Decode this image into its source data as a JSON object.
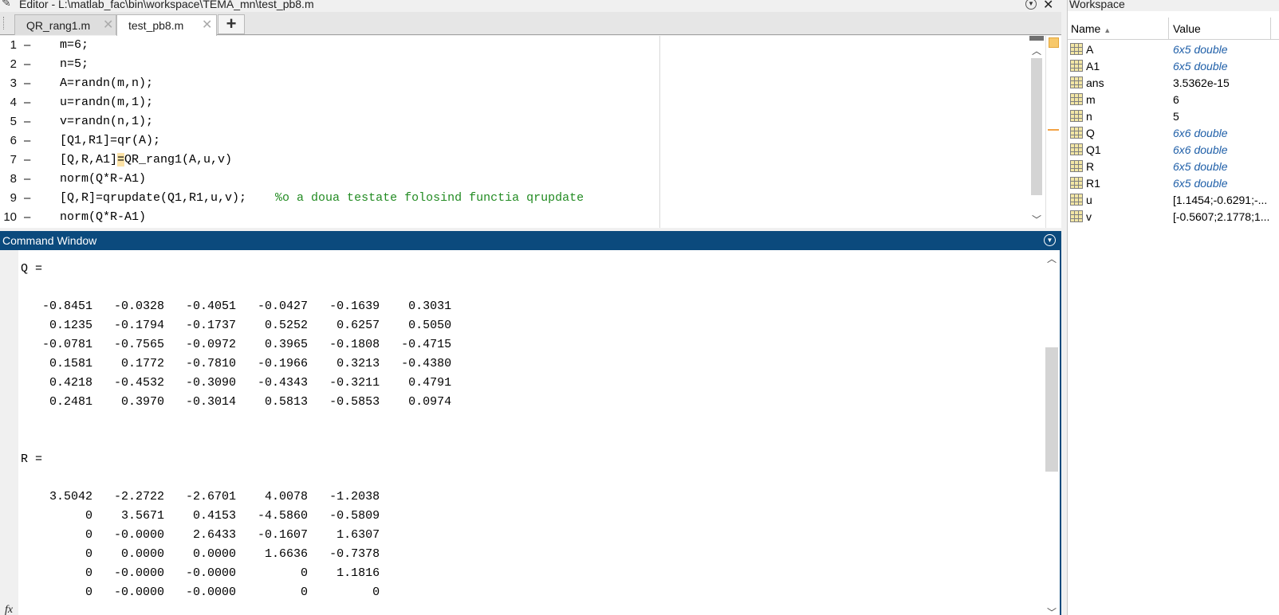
{
  "editor": {
    "title": "Editor - L:\\matlab_fac\\bin\\workspace\\TEMA_mn\\test_pb8.m",
    "tabs": [
      {
        "label": "QR_rang1.m"
      },
      {
        "label": "test_pb8.m"
      }
    ],
    "add_tab_label": "+",
    "lines": [
      {
        "num": "1",
        "code": "m=6;"
      },
      {
        "num": "2",
        "code": "n=5;"
      },
      {
        "num": "3",
        "code": "A=randn(m,n);"
      },
      {
        "num": "4",
        "code": "u=randn(m,1);"
      },
      {
        "num": "5",
        "code": "v=randn(n,1);"
      },
      {
        "num": "6",
        "code": "[Q1,R1]=qr(A);"
      },
      {
        "num": "7",
        "code_pre": "[Q,R,A1]",
        "code_hl": "=",
        "code_post": "QR_rang1(A,u,v)"
      },
      {
        "num": "8",
        "code": "norm(Q*R-A1)"
      },
      {
        "num": "9",
        "code": "[Q,R]=qrupdate(Q1,R1,u,v);    ",
        "comment": "%o a doua testate folosind functia qrupdate"
      },
      {
        "num": "10",
        "code": "norm(Q*R-A1)"
      }
    ]
  },
  "command_window": {
    "title": "Command Window",
    "lines": [
      "Q =",
      "",
      "   -0.8451   -0.0328   -0.4051   -0.0427   -0.1639    0.3031",
      "    0.1235   -0.1794   -0.1737    0.5252    0.6257    0.5050",
      "   -0.0781   -0.7565   -0.0972    0.3965   -0.1808   -0.4715",
      "    0.1581    0.1772   -0.7810   -0.1966    0.3213   -0.4380",
      "    0.4218   -0.4532   -0.3090   -0.4343   -0.3211    0.4791",
      "    0.2481    0.3970   -0.3014    0.5813   -0.5853    0.0974",
      "",
      "",
      "R =",
      "",
      "    3.5042   -2.2722   -2.6701    4.0078   -1.2038",
      "         0    3.5671    0.4153   -4.5860   -0.5809",
      "         0   -0.0000    2.6433   -0.1607    1.6307",
      "         0    0.0000    0.0000    1.6636   -0.7378",
      "         0   -0.0000   -0.0000         0    1.1816",
      "         0   -0.0000   -0.0000         0         0"
    ],
    "prompt_icon": "fx"
  },
  "workspace": {
    "title": "Workspace",
    "col_name": "Name",
    "sort_indicator": "▲",
    "col_value": "Value",
    "rows": [
      {
        "name": "A",
        "value": "6x5 double",
        "obj": true
      },
      {
        "name": "A1",
        "value": "6x5 double",
        "obj": true
      },
      {
        "name": "ans",
        "value": "3.5362e-15",
        "obj": false
      },
      {
        "name": "m",
        "value": "6",
        "obj": false
      },
      {
        "name": "n",
        "value": "5",
        "obj": false
      },
      {
        "name": "Q",
        "value": "6x6 double",
        "obj": true
      },
      {
        "name": "Q1",
        "value": "6x6 double",
        "obj": true
      },
      {
        "name": "R",
        "value": "6x5 double",
        "obj": true
      },
      {
        "name": "R1",
        "value": "6x5 double",
        "obj": true
      },
      {
        "name": "u",
        "value": "[1.1454;-0.6291;-...",
        "obj": false
      },
      {
        "name": "v",
        "value": "[-0.5607;2.1778;1...",
        "obj": false
      }
    ]
  },
  "colors": {
    "accent": "#0b4a7d",
    "comment": "#228b22",
    "object_value": "#1f5fa8",
    "highlight": "#fde3a7"
  },
  "icons": [
    "pencil-icon",
    "dropdown-icon",
    "close-icon",
    "tab-close-icon",
    "add-tab-icon",
    "scroll-up-icon",
    "scroll-down-icon",
    "variable-matrix-icon",
    "fx-icon"
  ]
}
